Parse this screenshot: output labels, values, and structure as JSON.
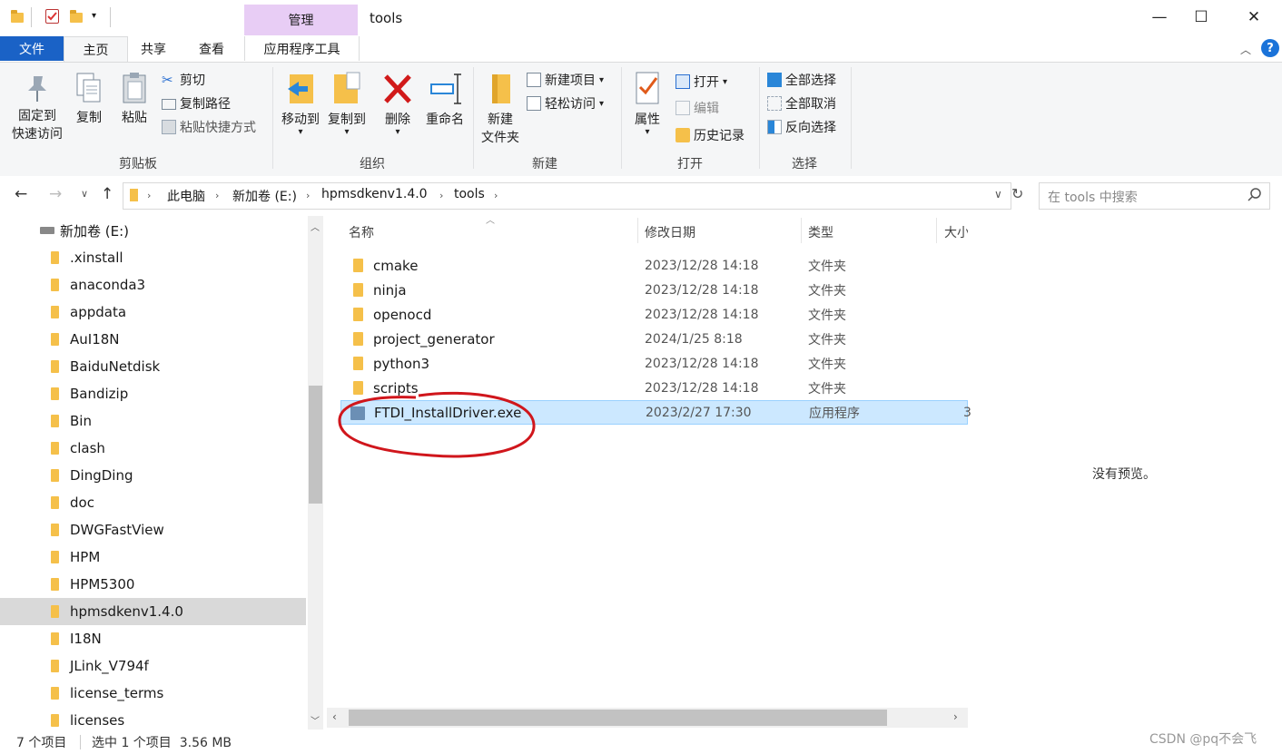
{
  "window": {
    "title": "tools",
    "manage_tab": "管理",
    "minimize": "—",
    "maximize": "☐",
    "close": "✕"
  },
  "ribbon_tabs": [
    {
      "label": "文件"
    },
    {
      "label": "主页"
    },
    {
      "label": "共享"
    },
    {
      "label": "查看"
    },
    {
      "label": "应用程序工具"
    }
  ],
  "ribbon": {
    "clipboard": {
      "group_label": "剪贴板",
      "pin_label_1": "固定到",
      "pin_label_2": "快速访问",
      "copy_label": "复制",
      "paste_label": "粘贴",
      "cut_label": "剪切",
      "copy_path_label": "复制路径",
      "paste_shortcut_label": "粘贴快捷方式"
    },
    "organize": {
      "group_label": "组织",
      "move_to_label": "移动到",
      "copy_to_label": "复制到",
      "delete_label": "删除",
      "rename_label": "重命名"
    },
    "new": {
      "group_label": "新建",
      "new_folder_label_1": "新建",
      "new_folder_label_2": "文件夹",
      "new_item_label": "新建项目",
      "easy_access_label": "轻松访问"
    },
    "open": {
      "group_label": "打开",
      "properties_label": "属性",
      "open_label": "打开",
      "edit_label": "编辑",
      "history_label": "历史记录"
    },
    "select": {
      "group_label": "选择",
      "select_all_label": "全部选择",
      "select_none_label": "全部取消",
      "invert_label": "反向选择"
    }
  },
  "address": {
    "crumbs": [
      "此电脑",
      "新加卷 (E:)",
      "hpmsdkenv1.4.0",
      "tools"
    ],
    "search_placeholder": "在 tools 中搜索"
  },
  "nav_tree": {
    "drive_label": "新加卷 (E:)",
    "items": [
      {
        "label": ".xinstall"
      },
      {
        "label": "anaconda3"
      },
      {
        "label": "appdata"
      },
      {
        "label": "AuI18N"
      },
      {
        "label": "BaiduNetdisk"
      },
      {
        "label": "Bandizip"
      },
      {
        "label": "Bin"
      },
      {
        "label": "clash"
      },
      {
        "label": "DingDing"
      },
      {
        "label": "doc"
      },
      {
        "label": "DWGFastView"
      },
      {
        "label": "HPM"
      },
      {
        "label": "HPM5300"
      },
      {
        "label": "hpmsdkenv1.4.0",
        "selected": true
      },
      {
        "label": "I18N"
      },
      {
        "label": "JLink_V794f"
      },
      {
        "label": "license_terms"
      },
      {
        "label": "licenses"
      }
    ]
  },
  "file_list": {
    "columns": {
      "name": "名称",
      "date": "修改日期",
      "type": "类型",
      "size": "大小"
    },
    "rows": [
      {
        "name": "cmake",
        "date": "2023/12/28 14:18",
        "type": "文件夹",
        "size": ""
      },
      {
        "name": "ninja",
        "date": "2023/12/28 14:18",
        "type": "文件夹",
        "size": ""
      },
      {
        "name": "openocd",
        "date": "2023/12/28 14:18",
        "type": "文件夹",
        "size": ""
      },
      {
        "name": "project_generator",
        "date": "2024/1/25 8:18",
        "type": "文件夹",
        "size": ""
      },
      {
        "name": "python3",
        "date": "2023/12/28 14:18",
        "type": "文件夹",
        "size": ""
      },
      {
        "name": "scripts",
        "date": "2023/12/28 14:18",
        "type": "文件夹",
        "size": ""
      },
      {
        "name": "FTDI_InstallDriver.exe",
        "date": "2023/2/27 17:30",
        "type": "应用程序",
        "size": "3",
        "selected": true
      }
    ]
  },
  "preview": {
    "text": "没有预览。"
  },
  "status": {
    "item_count": "7 个项目",
    "selection": "选中 1 个项目  3.56 MB"
  },
  "watermark": "CSDN @pq不会飞",
  "colors": {
    "file_tab": "#1a62c6",
    "manage_tab": "#e8cdf5",
    "selection": "#cce8ff",
    "annotation": "#d0161c"
  }
}
